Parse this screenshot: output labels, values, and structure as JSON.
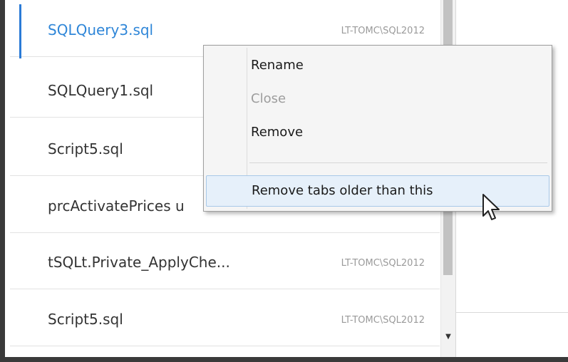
{
  "tabs": [
    {
      "name": "SQLQuery3.sql",
      "server": "LT-TOMC\\SQL2012",
      "selected": true
    },
    {
      "name": "SQLQuery1.sql",
      "server": ""
    },
    {
      "name": "Script5.sql",
      "server": ""
    },
    {
      "name": "prcActivatePrices u",
      "server": ""
    },
    {
      "name": "tSQLt.Private_ApplyChe...",
      "server": "LT-TOMC\\SQL2012"
    },
    {
      "name": "Script5.sql",
      "server": "LT-TOMC\\SQL2012"
    }
  ],
  "context_menu": {
    "items": [
      {
        "label": "Rename",
        "enabled": true
      },
      {
        "label": "Close",
        "enabled": false
      },
      {
        "label": "Remove",
        "enabled": true
      },
      {
        "label": "Remove tabs older than this",
        "enabled": true,
        "hovered": true
      }
    ]
  },
  "colors": {
    "selected_accent": "#2b7bd6",
    "selected_text": "#2f86d8",
    "menu_hover": "#e6f0fa"
  }
}
